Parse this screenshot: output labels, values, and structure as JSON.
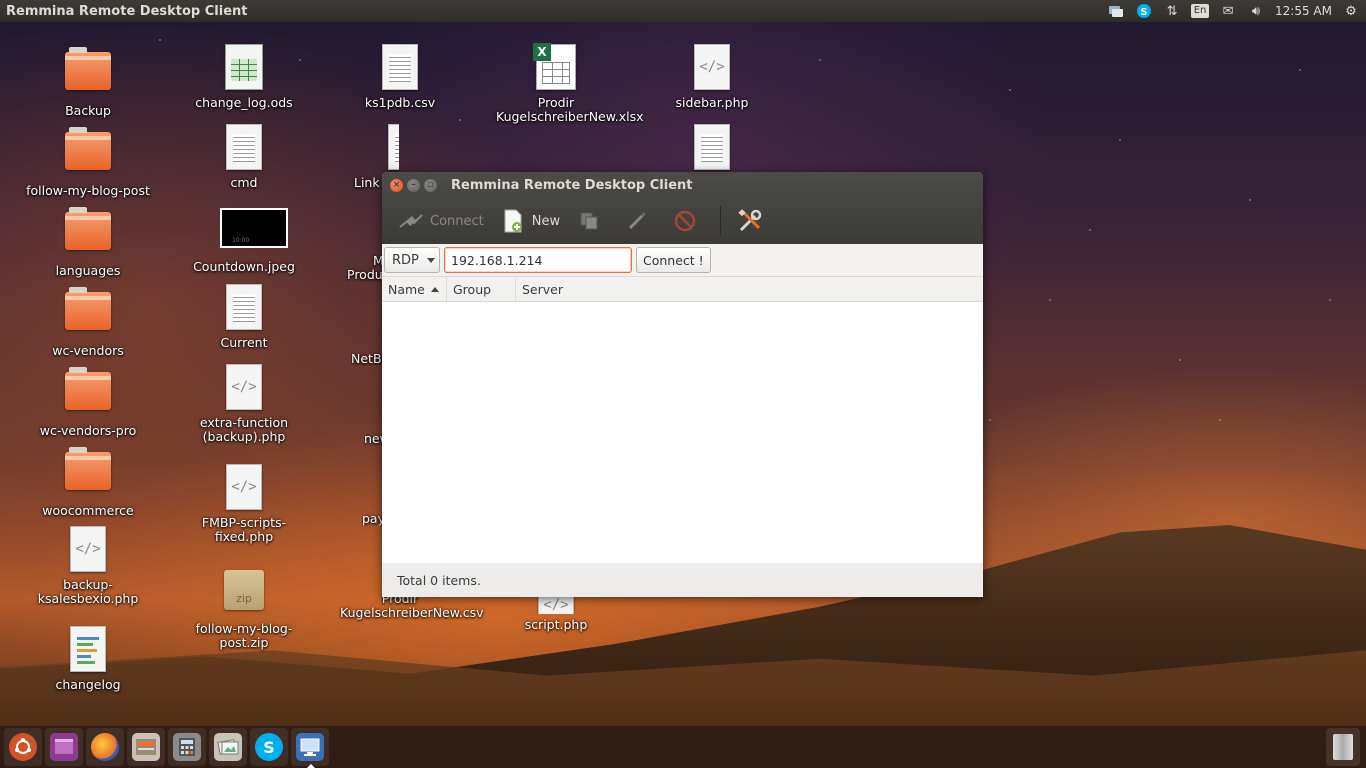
{
  "topbar": {
    "title": "Remmina Remote Desktop Client",
    "keyboard_layout": "En",
    "clock": "12:55 AM"
  },
  "desktop_icons": [
    {
      "label": "Backup",
      "icon": "folder-icon"
    },
    {
      "label": "follow-my-blog-post",
      "icon": "folder-icon"
    },
    {
      "label": "languages",
      "icon": "folder-icon"
    },
    {
      "label": "wc-vendors",
      "icon": "folder-icon"
    },
    {
      "label": "wc-vendors-pro",
      "icon": "folder-icon"
    },
    {
      "label": "woocommerce",
      "icon": "folder-icon"
    },
    {
      "label": "backup-ksalesbexio.php",
      "icon": "php-file-icon"
    },
    {
      "label": "changelog",
      "icon": "text-file-icon"
    },
    {
      "label": "change_log.ods",
      "icon": "spreadsheet-icon"
    },
    {
      "label": "cmd",
      "icon": "text-file-icon"
    },
    {
      "label": "Countdown.jpeg",
      "icon": "image-file-icon"
    },
    {
      "label": "Current",
      "icon": "text-file-icon"
    },
    {
      "label": "extra-function (backup).php",
      "icon": "php-file-icon"
    },
    {
      "label": "FMBP-scripts-fixed.php",
      "icon": "php-file-icon"
    },
    {
      "label": "follow-my-blog-post.zip",
      "icon": "zip-file-icon"
    },
    {
      "label": "ks1pdb.csv",
      "icon": "text-file-icon"
    },
    {
      "label": "Link",
      "icon": "text-file-icon"
    },
    {
      "label": "M",
      "icon": "file-icon"
    },
    {
      "label": "Produ",
      "icon": "file-icon"
    },
    {
      "label": "NetBe",
      "icon": "file-icon"
    },
    {
      "label": "new",
      "icon": "file-icon"
    },
    {
      "label": "pay",
      "icon": "file-icon"
    },
    {
      "label": "Prodir KugelschreiberNew.csv",
      "icon": "text-file-icon"
    },
    {
      "label": "Prodir KugelschreiberNew.xlsx",
      "icon": "excel-file-icon"
    },
    {
      "label": "script.php",
      "icon": "php-file-icon"
    },
    {
      "label": "sidebar.php",
      "icon": "php-file-icon"
    },
    {
      "label": "",
      "icon": "text-file-icon"
    }
  ],
  "window": {
    "title": "Remmina Remote Desktop Client",
    "toolbar": {
      "connect_label": "Connect",
      "new_label": "New"
    },
    "quickconnect": {
      "protocol": "RDP",
      "server_value": "192.168.1.214",
      "connect_label": "Connect !"
    },
    "columns": {
      "name": "Name",
      "group": "Group",
      "server": "Server"
    },
    "status": "Total 0 items."
  },
  "launcher": [
    {
      "name": "ubuntu-dash-icon",
      "color": "#d0532a"
    },
    {
      "name": "files-app-icon",
      "color": "#8e3a8e"
    },
    {
      "name": "firefox-icon",
      "color": "#e8702a"
    },
    {
      "name": "file-manager-icon",
      "color": "#c9c2b5"
    },
    {
      "name": "calculator-icon",
      "color": "#8a8a8a"
    },
    {
      "name": "shotwell-icon",
      "color": "#c9c2b5"
    },
    {
      "name": "skype-icon",
      "color": "#00aff0"
    },
    {
      "name": "remmina-icon",
      "color": "#3b6fb6"
    }
  ]
}
